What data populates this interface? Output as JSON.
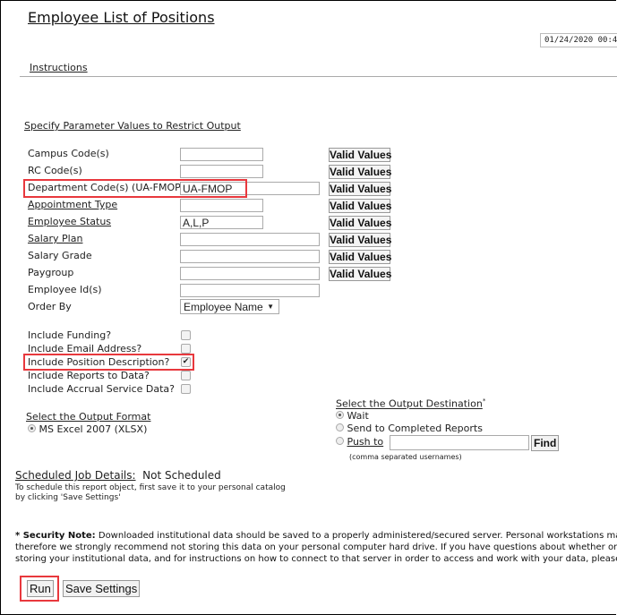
{
  "header": {
    "title": "Employee List of Positions",
    "date_value": "01/24/2020 00:4",
    "instructions_link": "Instructions"
  },
  "params": {
    "section_title": "Specify Parameter Values to Restrict Output",
    "valid_values_label": "Valid Values",
    "rows": [
      {
        "label": "Campus Code(s)",
        "value": "",
        "link": false
      },
      {
        "label": "RC Code(s)",
        "value": "",
        "link": false
      },
      {
        "label": "Department Code(s) (UA-FMOP)",
        "value": "UA-FMOP",
        "link": false
      },
      {
        "label": "Appointment Type",
        "value": "",
        "link": true
      },
      {
        "label": "Employee Status",
        "value": "A,L,P",
        "link": true
      },
      {
        "label": "Salary Plan",
        "value": "",
        "link": true
      },
      {
        "label": "Salary Grade",
        "value": "",
        "link": false
      },
      {
        "label": "Paygroup",
        "value": "",
        "link": false
      },
      {
        "label": "Employee Id(s)",
        "value": "",
        "link": false
      }
    ],
    "order_by_label": "Order By",
    "order_by_value": "Employee Name"
  },
  "options": [
    {
      "label": "Include Funding?",
      "checked": false
    },
    {
      "label": "Include Email Address?",
      "checked": false
    },
    {
      "label": "Include Position Description?",
      "checked": true
    },
    {
      "label": "Include Reports to Data?",
      "checked": false
    },
    {
      "label": "Include Accrual Service Data?",
      "checked": false
    }
  ],
  "output_format": {
    "title": "Select the Output Format",
    "selected": "MS Excel 2007 (XLSX)"
  },
  "output_destination": {
    "title": "Select the Output Destination",
    "required_mark": "*",
    "options": [
      "Wait",
      "Send to Completed Reports",
      "Push to"
    ],
    "selected": "Wait",
    "push_to_value": "",
    "find_label": "Find",
    "hint": "(comma separated usernames)"
  },
  "schedule": {
    "label": "Scheduled Job Details:",
    "status": "Not Scheduled",
    "line1": "To schedule this report object, first save it to your personal catalog",
    "line2": "by clicking 'Save Settings'"
  },
  "security_note": {
    "prefix": "* Security Note:",
    "line1": " Downloaded institutional data should be saved to a properly administered/secured server. Personal workstations may not b",
    "line2": "therefore we strongly recommend not storing this data on your personal computer hard drive. If you have questions about whether or not yo",
    "line3": "storing your institutional data, and for instructions on how to connect to that server in order to access and work with your data, please con"
  },
  "actions": {
    "run_label": "Run",
    "save_label": "Save Settings"
  },
  "highlight_color": "#e8383d"
}
